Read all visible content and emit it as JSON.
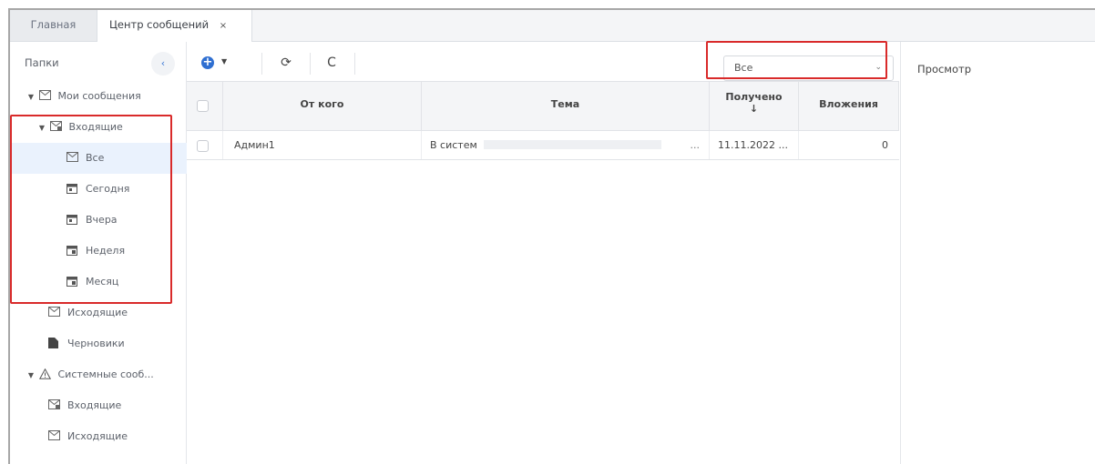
{
  "tabs": [
    {
      "label": "Главная"
    },
    {
      "label": "Центр сообщений",
      "close": "×"
    }
  ],
  "sidebar": {
    "title": "Папки",
    "collapse": "‹",
    "tree": [
      {
        "label": "Мои сообщения",
        "caret": "▼"
      },
      {
        "label": "Входящие",
        "caret": "▼"
      },
      {
        "label": "Все"
      },
      {
        "label": "Сегодня"
      },
      {
        "label": "Вчера"
      },
      {
        "label": "Неделя"
      },
      {
        "label": "Месяц"
      },
      {
        "label": "Исходящие"
      },
      {
        "label": "Черновики"
      },
      {
        "label": "Системные сооб...",
        "caret": "▼"
      },
      {
        "label": "Входящие"
      },
      {
        "label": "Исходящие"
      }
    ]
  },
  "toolbar": {
    "add": "+",
    "add_dropdown": "▼",
    "sync": "⟳",
    "refresh": "C",
    "filter": {
      "value": "Все",
      "caret": "⌄"
    }
  },
  "grid": {
    "columns": [
      "От кого",
      "Тема",
      "Получено",
      "Вложения"
    ],
    "sort_arrow": "↓",
    "rows": [
      {
        "from": "Админ1",
        "subject": "В систем",
        "ellipsis": "...",
        "received": "11.11.2022 ...",
        "attachments": "0"
      }
    ]
  },
  "preview": {
    "title": "Просмотр"
  },
  "colors": {
    "accent": "#2f6fd1",
    "highlight": "#d92a2a",
    "selected": "#eaf2fd"
  }
}
